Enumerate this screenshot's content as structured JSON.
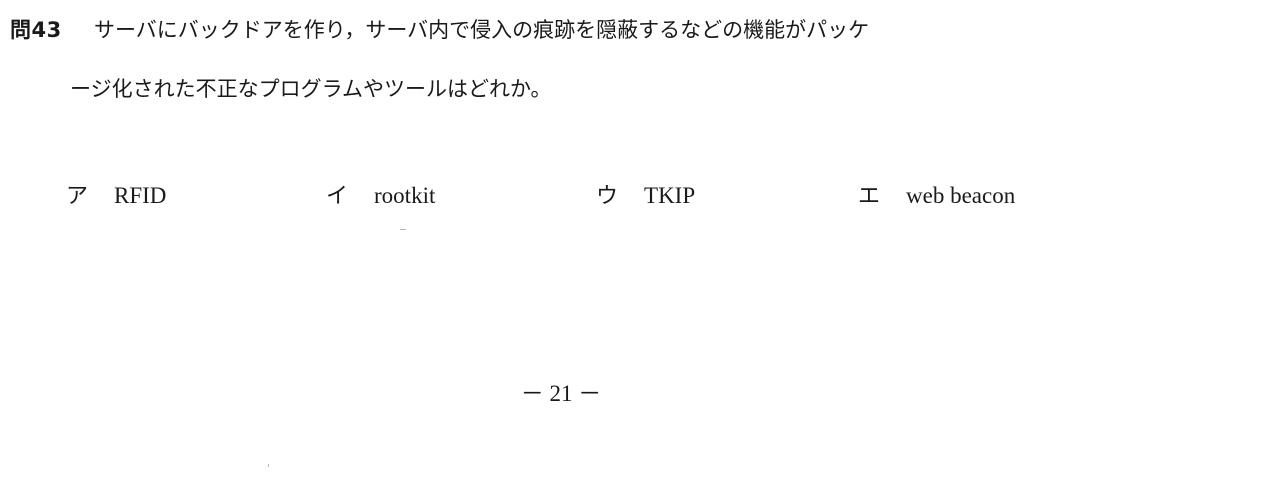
{
  "question": {
    "number": "問43",
    "line1": "サーバにバックドアを作り，サーバ内で侵入の痕跡を隠蔽するなどの機能がパッケ",
    "line2": "ージ化された不正なプログラムやツールはどれか。"
  },
  "choices": [
    {
      "mark": "ア",
      "text": "RFID"
    },
    {
      "mark": "イ",
      "text": "rootkit"
    },
    {
      "mark": "ウ",
      "text": "TKIP"
    },
    {
      "mark": "エ",
      "text": "web beacon"
    }
  ],
  "footer": {
    "page_number": "－ 21 －"
  }
}
